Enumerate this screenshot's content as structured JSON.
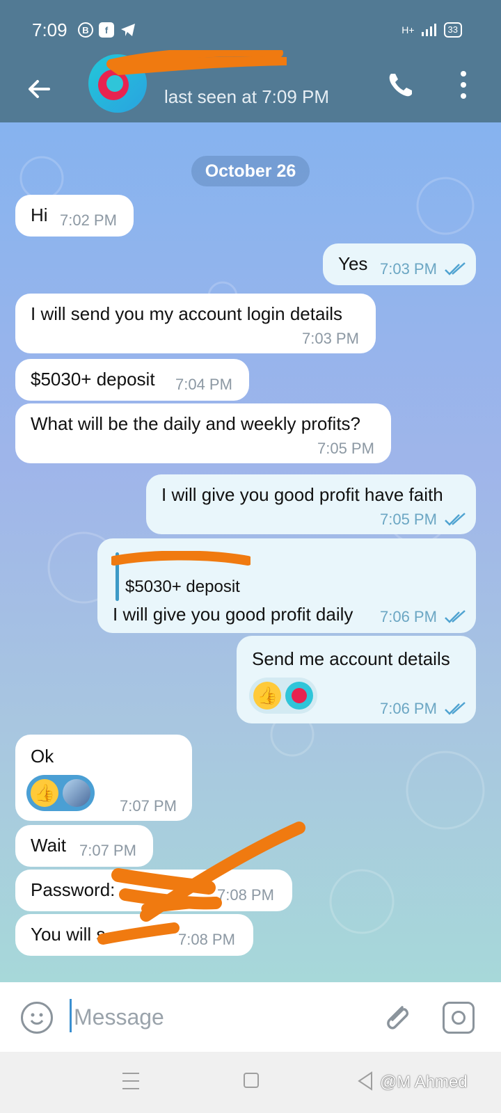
{
  "status_bar": {
    "time": "7:09",
    "network": "H+",
    "battery": "33"
  },
  "header": {
    "last_seen": "last seen at 7:09 PM"
  },
  "chat": {
    "date": "October 26",
    "messages": [
      {
        "text": "Hi",
        "time": "7:02 PM"
      },
      {
        "text": "Yes",
        "time": "7:03 PM"
      },
      {
        "text": "I will send you my account login details",
        "time": "7:03 PM"
      },
      {
        "text": "$5030+ deposit",
        "time": "7:04 PM"
      },
      {
        "text": "What will be the daily and weekly profits?",
        "time": "7:05 PM"
      },
      {
        "text": "I will give you good profit have faith",
        "time": "7:05 PM"
      },
      {
        "quote": "$5030+ deposit",
        "text": "I will give you good profit daily",
        "time": "7:06 PM"
      },
      {
        "text": "Send me account details",
        "time": "7:06 PM"
      },
      {
        "text": "Ok",
        "time": "7:07 PM"
      },
      {
        "text": "Wait",
        "time": "7:07 PM"
      },
      {
        "text": "Password:",
        "time": "7:08 PM"
      },
      {
        "text": "You will s",
        "time": "7:08 PM"
      }
    ]
  },
  "composer": {
    "placeholder": "Message"
  },
  "watermark": "@M Ahmed",
  "colors": {
    "header": "#527a94",
    "incoming": "#ffffff",
    "outgoing": "#e9f6fb",
    "redaction": "#f07a10",
    "tick": "#4fa3d1"
  }
}
